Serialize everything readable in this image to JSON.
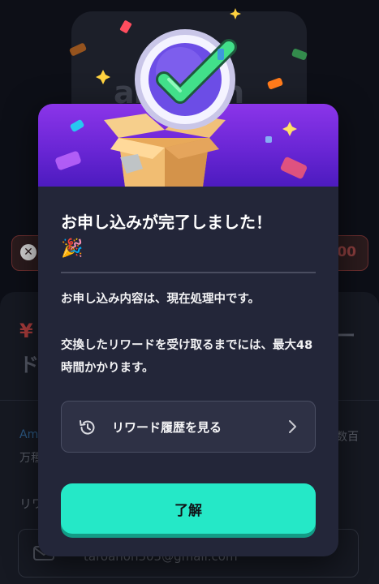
{
  "background": {
    "logo_text": "amazon",
    "error_amount": "00",
    "price_symbol": "¥",
    "title_fragment_right": "ー",
    "title_fragment_left": "ド",
    "desc_left_1": "Am",
    "desc_left_2": "万種",
    "desc_right": "数百",
    "reward_label": "リワ",
    "email_value": "taroanon505@gmail.com"
  },
  "modal": {
    "title": "お申し込みが完了しました！",
    "party_emoji": "🎉",
    "body_line_1": "お申し込み内容は、現在処理中です。",
    "body_line_2": "交換したリワードを受け取るまでには、最大48時間かかります。",
    "history_button_label": "リワード履歴を見る",
    "ok_button_label": "了解"
  },
  "colors": {
    "primary_button": "#25e8c7",
    "modal_background": "#232639",
    "hero_purple": "#7a2fe0",
    "checkmark_green": "#3ee07a"
  },
  "icons": {
    "history": "history-clock-icon",
    "chevron": "chevron-right-icon",
    "check": "check-badge-icon",
    "error": "error-x-icon",
    "email": "mail-icon"
  }
}
